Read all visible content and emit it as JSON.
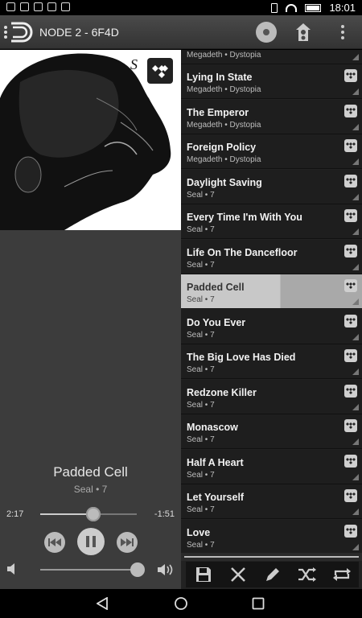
{
  "status": {
    "time": "18:01"
  },
  "header": {
    "device_name": "NODE 2 - 6F4D"
  },
  "now_playing": {
    "title": "Padded Cell",
    "subtitle": "Seal • 7",
    "elapsed": "2:17",
    "remaining": "-1:51",
    "progress": 0.55,
    "volume": 0.99,
    "album_letters": "S E"
  },
  "queue": {
    "partial_top": "Megadeth • Dystopia",
    "items": [
      {
        "title": "Lying In State",
        "subtitle": "Megadeth • Dystopia"
      },
      {
        "title": "The Emperor",
        "subtitle": "Megadeth • Dystopia"
      },
      {
        "title": "Foreign Policy",
        "subtitle": "Megadeth • Dystopia"
      },
      {
        "title": "Daylight Saving",
        "subtitle": "Seal • 7"
      },
      {
        "title": "Every Time I'm With You",
        "subtitle": "Seal • 7"
      },
      {
        "title": "Life On The Dancefloor",
        "subtitle": "Seal • 7"
      },
      {
        "title": "Padded Cell",
        "subtitle": "Seal • 7",
        "current": true
      },
      {
        "title": "Do You Ever",
        "subtitle": "Seal • 7"
      },
      {
        "title": "The Big Love Has Died",
        "subtitle": "Seal • 7"
      },
      {
        "title": "Redzone Killer",
        "subtitle": "Seal • 7"
      },
      {
        "title": "Monascow",
        "subtitle": "Seal • 7"
      },
      {
        "title": "Half A Heart",
        "subtitle": "Seal • 7"
      },
      {
        "title": "Let Yourself",
        "subtitle": "Seal • 7"
      },
      {
        "title": "Love",
        "subtitle": "Seal • 7"
      }
    ]
  },
  "toolbar": {
    "save_icon": "save-icon",
    "clear_icon": "close-icon",
    "edit_icon": "pencil-icon",
    "shuffle_icon": "shuffle-icon",
    "repeat_icon": "repeat-icon"
  }
}
